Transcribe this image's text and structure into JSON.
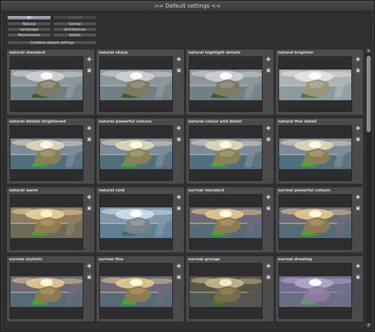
{
  "window": {
    "title": ">> Default settings <<"
  },
  "filters": {
    "all": "All",
    "custom": "Custom",
    "natural": "Natural",
    "surreal": "Surreal",
    "landscape": "Landscape",
    "architecture": "Architecture",
    "monochrome": "Monochrome",
    "artistic": "Artistic",
    "combine": "Combine default settings"
  },
  "presets": [
    {
      "name": "natural standard",
      "style": "natural"
    },
    {
      "name": "natural sharp",
      "style": "natural"
    },
    {
      "name": "natural highlight details",
      "style": "natural"
    },
    {
      "name": "natural brighten",
      "style": "bright"
    },
    {
      "name": "natural details brightened",
      "style": "vivid"
    },
    {
      "name": "natural powerful colours",
      "style": "vivid"
    },
    {
      "name": "natural colour and detail",
      "style": "vivid"
    },
    {
      "name": "natural fine detail",
      "style": "vivid"
    },
    {
      "name": "natural warm",
      "style": "warm"
    },
    {
      "name": "natural cold",
      "style": "cold"
    },
    {
      "name": "surreal standard",
      "style": "surreal"
    },
    {
      "name": "surreal powerful colours",
      "style": "surreal"
    },
    {
      "name": "surreal stylistic",
      "style": "surreal"
    },
    {
      "name": "surreal fine",
      "style": "surreal"
    },
    {
      "name": "surreal grunge",
      "style": "grunge"
    },
    {
      "name": "surreal drawing",
      "style": "drawing"
    }
  ],
  "icons": {
    "add": "plus-icon",
    "save": "save-icon"
  },
  "colors": {
    "accent": "#9a9ab0",
    "card": "#4b4b4b",
    "background": "#303030"
  }
}
